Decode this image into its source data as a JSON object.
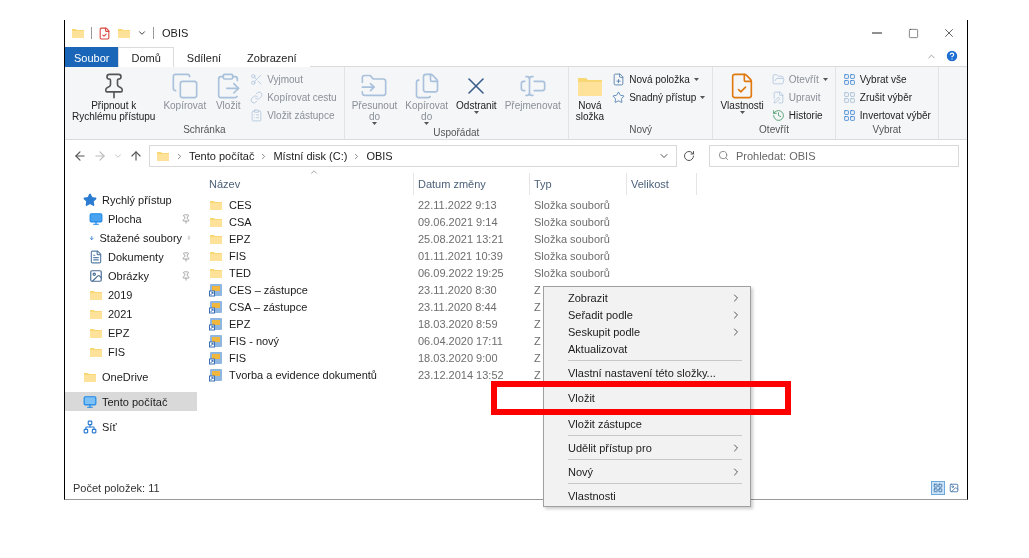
{
  "window": {
    "title": "OBIS"
  },
  "ribbon_tabs": [
    {
      "label": "Soubor",
      "kind": "file",
      "selected": false
    },
    {
      "label": "Domů",
      "kind": "tab",
      "selected": true
    },
    {
      "label": "Sdílení",
      "kind": "tab",
      "selected": false
    },
    {
      "label": "Zobrazení",
      "kind": "tab",
      "selected": false
    }
  ],
  "ribbon_groups": [
    {
      "label": "Schránka",
      "items": [
        {
          "kind": "large",
          "lines": [
            "Připnout k",
            "Rychlému přístupu"
          ],
          "disabled": false,
          "dropdown": false
        },
        {
          "kind": "large",
          "lines": [
            "Kopírovat"
          ],
          "disabled": true,
          "dropdown": false
        },
        {
          "kind": "large",
          "lines": [
            "Vložit"
          ],
          "disabled": true,
          "dropdown": false
        },
        {
          "kind": "small",
          "lines": [
            "Vyjmout"
          ],
          "disabled": true,
          "dropdown": false
        },
        {
          "kind": "small",
          "lines": [
            "Kopírovat cestu"
          ],
          "disabled": true,
          "dropdown": false
        },
        {
          "kind": "small",
          "lines": [
            "Vložit zástupce"
          ],
          "disabled": true,
          "dropdown": false
        }
      ]
    },
    {
      "label": "Uspořádat",
      "items": [
        {
          "kind": "large",
          "lines": [
            "Přesunout",
            "do"
          ],
          "disabled": true,
          "dropdown": true
        },
        {
          "kind": "large",
          "lines": [
            "Kopírovat",
            "do"
          ],
          "disabled": true,
          "dropdown": true
        },
        {
          "kind": "large",
          "lines": [
            "Odstranit"
          ],
          "disabled": false,
          "dropdown": true
        },
        {
          "kind": "large",
          "lines": [
            "Přejmenovat"
          ],
          "disabled": true,
          "dropdown": false
        }
      ]
    },
    {
      "label": "Nový",
      "items": [
        {
          "kind": "large",
          "lines": [
            "Nová",
            "složka"
          ],
          "disabled": false,
          "dropdown": false
        },
        {
          "kind": "small",
          "lines": [
            "Nová položka"
          ],
          "disabled": false,
          "dropdown": true
        },
        {
          "kind": "small",
          "lines": [
            "Snadný přístup"
          ],
          "disabled": false,
          "dropdown": true
        }
      ]
    },
    {
      "label": "Otevřít",
      "items": [
        {
          "kind": "large",
          "lines": [
            "Vlastnosti"
          ],
          "disabled": false,
          "dropdown": true
        },
        {
          "kind": "small",
          "lines": [
            "Otevřít"
          ],
          "disabled": true,
          "dropdown": true
        },
        {
          "kind": "small",
          "lines": [
            "Upravit"
          ],
          "disabled": true,
          "dropdown": false
        },
        {
          "kind": "small",
          "lines": [
            "Historie"
          ],
          "disabled": false,
          "dropdown": false
        }
      ]
    },
    {
      "label": "Vybrat",
      "items": [
        {
          "kind": "small",
          "lines": [
            "Vybrat vše"
          ],
          "disabled": false,
          "dropdown": false
        },
        {
          "kind": "small",
          "lines": [
            "Zrušit výběr"
          ],
          "disabled": false,
          "dropdown": false
        },
        {
          "kind": "small",
          "lines": [
            "Invertovat výběr"
          ],
          "disabled": false,
          "dropdown": false
        }
      ]
    }
  ],
  "address": {
    "breadcrumbs": [
      "Tento počítač",
      "Místní disk (C:)",
      "OBIS"
    ]
  },
  "search": {
    "placeholder": "Prohledat: OBIS"
  },
  "navigation": [
    {
      "label": "Rychlý přístup",
      "kind": "star",
      "selected": false,
      "pinned": false,
      "children": [
        {
          "label": "Plocha",
          "kind": "desktop",
          "selected": false,
          "pinned": true
        },
        {
          "label": "Stažené soubory",
          "kind": "download",
          "selected": false,
          "pinned": true
        },
        {
          "label": "Dokumenty",
          "kind": "document",
          "selected": false,
          "pinned": true
        },
        {
          "label": "Obrázky",
          "kind": "picture",
          "selected": false,
          "pinned": true
        },
        {
          "label": "2019",
          "kind": "folder",
          "selected": false,
          "pinned": false
        },
        {
          "label": "2021",
          "kind": "folder",
          "selected": false,
          "pinned": false
        },
        {
          "label": "EPZ",
          "kind": "folder",
          "selected": false,
          "pinned": false
        },
        {
          "label": "FIS",
          "kind": "folder",
          "selected": false,
          "pinned": false
        }
      ]
    },
    {
      "label": "OneDrive",
      "kind": "folder",
      "selected": false,
      "pinned": false
    },
    {
      "label": "Tento počítač",
      "kind": "computer",
      "selected": true,
      "pinned": false
    },
    {
      "label": "Síť",
      "kind": "network",
      "selected": false,
      "pinned": false
    }
  ],
  "columns": [
    {
      "label": "Název",
      "sorted": true
    },
    {
      "label": "Datum změny",
      "sorted": false
    },
    {
      "label": "Typ",
      "sorted": false
    },
    {
      "label": "Velikost",
      "sorted": false
    }
  ],
  "files": [
    {
      "name": "CES",
      "date": "22.11.2022 9:13",
      "type": "Složka souborů",
      "kind": "folder"
    },
    {
      "name": "CSA",
      "date": "09.06.2021 9:14",
      "type": "Složka souborů",
      "kind": "folder"
    },
    {
      "name": "EPZ",
      "date": "25.08.2021 13:21",
      "type": "Složka souborů",
      "kind": "folder"
    },
    {
      "name": "FIS",
      "date": "01.11.2021 10:39",
      "type": "Složka souborů",
      "kind": "folder"
    },
    {
      "name": "TED",
      "date": "06.09.2022 19:25",
      "type": "Složka souborů",
      "kind": "folder"
    },
    {
      "name": "CES – zástupce",
      "date": "23.11.2020 8:30",
      "type": "Z",
      "kind": "shortcut"
    },
    {
      "name": "CSA – zástupce",
      "date": "23.11.2020 8:44",
      "type": "Z",
      "kind": "shortcut"
    },
    {
      "name": "EPZ",
      "date": "18.03.2020 8:59",
      "type": "Z",
      "kind": "shortcut"
    },
    {
      "name": "FIS - nový",
      "date": "06.04.2020 17:11",
      "type": "Z",
      "kind": "shortcut"
    },
    {
      "name": "FIS",
      "date": "18.03.2020 9:00",
      "type": "Z",
      "kind": "shortcut"
    },
    {
      "name": "Tvorba a evidence dokumentů",
      "date": "23.12.2014 13:52",
      "type": "Z",
      "kind": "shortcut"
    }
  ],
  "context_menu": [
    {
      "kind": "item",
      "label": "Zobrazit",
      "submenu": true,
      "highlighted": false
    },
    {
      "kind": "item",
      "label": "Seřadit podle",
      "submenu": true,
      "highlighted": false
    },
    {
      "kind": "item",
      "label": "Seskupit podle",
      "submenu": true,
      "highlighted": false
    },
    {
      "kind": "item",
      "label": "Aktualizovat",
      "submenu": false,
      "highlighted": false
    },
    {
      "kind": "separator"
    },
    {
      "kind": "item",
      "label": "Vlastní nastavení této složky...",
      "submenu": false,
      "highlighted": false
    },
    {
      "kind": "item",
      "label": "Vložit",
      "submenu": false,
      "highlighted": true
    },
    {
      "kind": "item",
      "label": "Vložit zástupce",
      "submenu": false,
      "highlighted": false
    },
    {
      "kind": "separator"
    },
    {
      "kind": "item",
      "label": "Udělit přístup pro",
      "submenu": true,
      "highlighted": false
    },
    {
      "kind": "separator"
    },
    {
      "kind": "item",
      "label": "Nový",
      "submenu": true,
      "highlighted": false
    },
    {
      "kind": "separator"
    },
    {
      "kind": "item",
      "label": "Vlastnosti",
      "submenu": false,
      "highlighted": false
    }
  ],
  "status_bar": {
    "text": "Počet položek: 11"
  },
  "view_modes": [
    {
      "kind": "details",
      "selected": true
    },
    {
      "kind": "large_icons",
      "selected": false
    }
  ]
}
